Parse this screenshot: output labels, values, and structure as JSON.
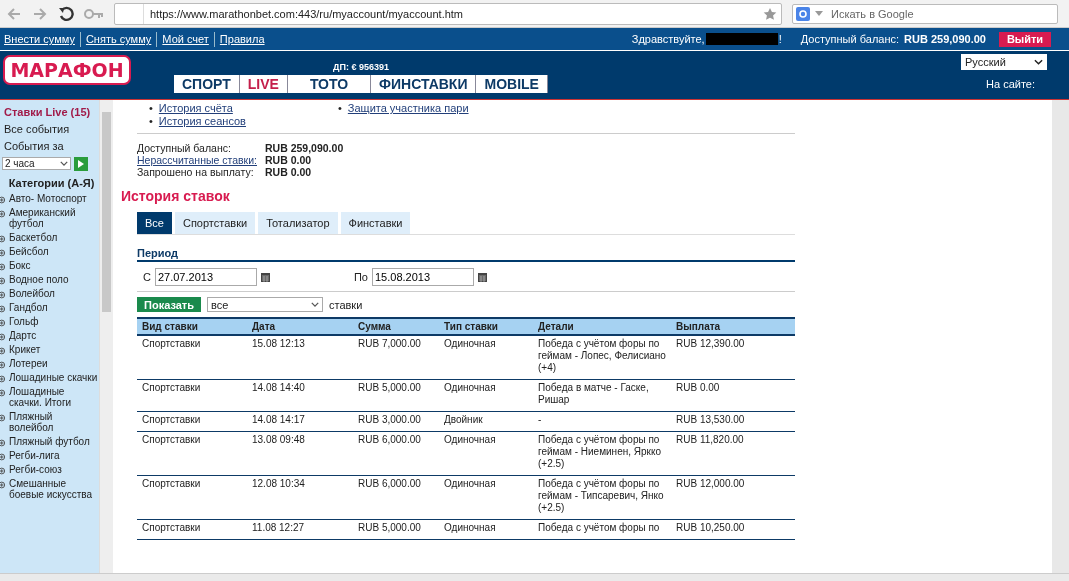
{
  "browser": {
    "url": "https://www.marathonbet.com:443/ru/myaccount/myaccount.htm",
    "search_placeholder": "Искать в Google"
  },
  "topbar": {
    "links": [
      "Внести сумму",
      "Снять сумму",
      "Мой счет",
      "Правила"
    ],
    "greeting": "Здравствуйте,",
    "greeting_end": "!",
    "balance_label": "Доступный баланс:",
    "balance_value": "RUB 259,090.00",
    "logout": "Выйти"
  },
  "header": {
    "logo": "МАРАФОН",
    "dp": "ДП: € 956391",
    "language": "Русский",
    "online": "На сайте:",
    "nav": [
      {
        "label": "СПОРТ",
        "color": "#0d3a66"
      },
      {
        "label": "LIVE",
        "color": "#c41f4b"
      },
      {
        "label": "ТОТО",
        "color": "#0d3a66"
      },
      {
        "label": "ФИНСТАВКИ",
        "color": "#0d3a66"
      },
      {
        "label": "MOBILE",
        "color": "#0d3a66"
      }
    ]
  },
  "sidebar": {
    "live": "Ставки Live (15)",
    "all_events": "Все события",
    "events_for": "События за",
    "period": "2 часа",
    "categories_title": "Категории (А-Я)",
    "categories": [
      "Авто- Мотоспорт",
      "Американский футбол",
      "Баскетбол",
      "Бейсбол",
      "Бокс",
      "Водное поло",
      "Волейбол",
      "Гандбол",
      "Гольф",
      "Дартс",
      "Крикет",
      "Лотереи",
      "Лошадиные скачки",
      "Лошадиные скачки. Итоги",
      "Пляжный волейбол",
      "Пляжный футбол",
      "Регби-лига",
      "Регби-союз",
      "Смешанные боевые искусства"
    ]
  },
  "account_links": {
    "bullet": "•",
    "left": [
      "История счёта",
      "История сеансов"
    ],
    "right": [
      "Защита участника пари"
    ]
  },
  "balance": [
    {
      "label": "Доступный баланс:",
      "value": "RUB 259,090.00",
      "link": false
    },
    {
      "label": "Нерассчитанные ставки:",
      "value": "RUB 0.00",
      "link": true
    },
    {
      "label": "Запрошено на выплату:",
      "value": "RUB 0.00",
      "link": false
    }
  ],
  "history": {
    "title": "История ставок",
    "tabs": [
      {
        "label": "Все",
        "selected": true
      },
      {
        "label": "Спортставки",
        "selected": false
      },
      {
        "label": "Тотализатор",
        "selected": false
      },
      {
        "label": "Финставки",
        "selected": false
      }
    ],
    "period_title": "Период",
    "from_label": "С",
    "from": "27.07.2013",
    "to_label": "По",
    "to": "15.08.2013",
    "show_button": "Показать",
    "filter": "все",
    "filter_suffix": "ставки",
    "table": {
      "columns": [
        "Вид ставки",
        "Дата",
        "Сумма",
        "Тип ставки",
        "Детали",
        "Выплата"
      ],
      "rows": [
        [
          "Спортставки",
          "15.08 12:13",
          "RUB 7,000.00",
          "Одиночная",
          "Победа с учётом форы по геймам - Лопес, Фелисиано (+4)",
          "RUB 12,390.00"
        ],
        [
          "Спортставки",
          "14.08 14:40",
          "RUB 5,000.00",
          "Одиночная",
          "Победа в матче - Гаске, Ришар",
          "RUB 0.00"
        ],
        [
          "Спортставки",
          "14.08 14:17",
          "RUB 3,000.00",
          "Двойник",
          "-",
          "RUB 13,530.00"
        ],
        [
          "Спортставки",
          "13.08 09:48",
          "RUB 6,000.00",
          "Одиночная",
          "Победа с учётом форы по геймам - Ниеминен, Яркко (+2.5)",
          "RUB 11,820.00"
        ],
        [
          "Спортставки",
          "12.08 10:34",
          "RUB 6,000.00",
          "Одиночная",
          "Победа с учётом форы по геймам - Типсаревич, Янко (+2.5)",
          "RUB 12,000.00"
        ],
        [
          "Спортставки",
          "11.08 12:27",
          "RUB 5,000.00",
          "Одиночная",
          "Победа с учётом форы по",
          "RUB 10,250.00"
        ]
      ]
    }
  }
}
